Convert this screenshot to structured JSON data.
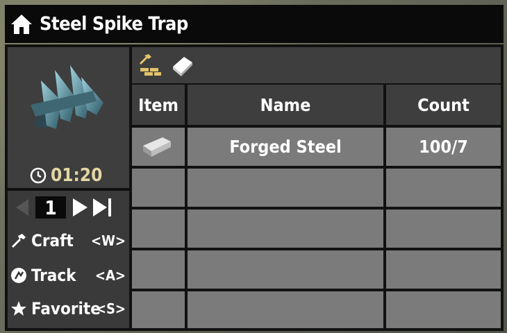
{
  "window": {
    "title": "Steel Spike Trap"
  },
  "recipe": {
    "craft_time": "01:20"
  },
  "pager": {
    "page": "1"
  },
  "commands": [
    {
      "label": "Craft",
      "key": "<W>",
      "icon": "hammer-icon"
    },
    {
      "label": "Track",
      "key": "<A>",
      "icon": "track-icon"
    },
    {
      "label": "Favorite",
      "key": "<S>",
      "icon": "star-icon"
    }
  ],
  "toolbar": {
    "buttons": [
      "build-tools-icon",
      "recipe-book-icon"
    ]
  },
  "table": {
    "headers": {
      "item": "Item",
      "name": "Name",
      "count": "Count"
    },
    "rows": [
      {
        "name": "Forged Steel",
        "count": "100/7",
        "icon": "forged-steel-icon"
      },
      {
        "name": "",
        "count": ""
      },
      {
        "name": "",
        "count": ""
      },
      {
        "name": "",
        "count": ""
      },
      {
        "name": "",
        "count": ""
      }
    ]
  }
}
